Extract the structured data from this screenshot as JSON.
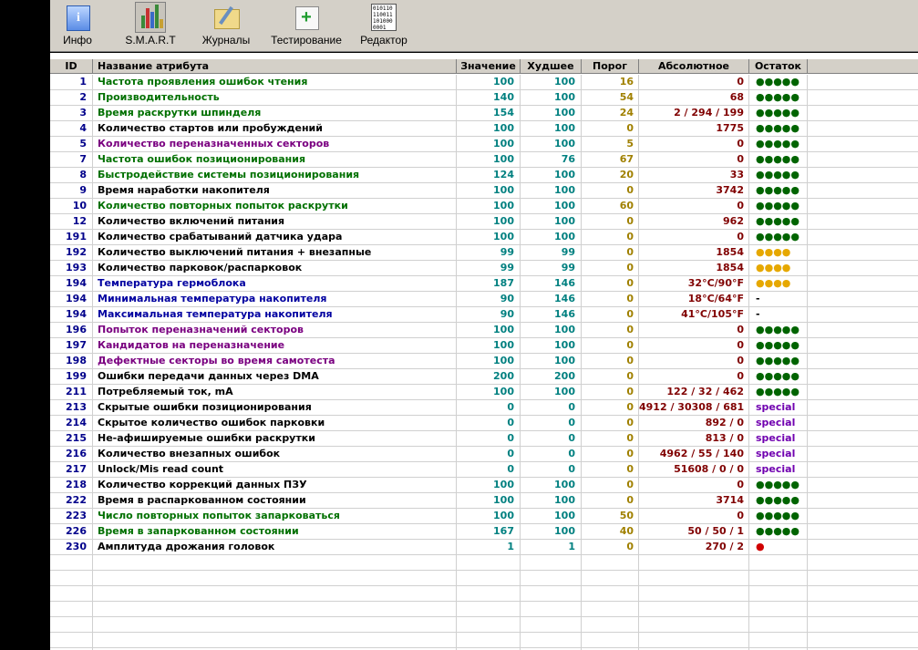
{
  "toolbar": {
    "buttons": [
      {
        "label": "Инфо",
        "icon": "info-icon"
      },
      {
        "label": "S.M.A.R.T",
        "icon": "smart-chart-icon"
      },
      {
        "label": "Журналы",
        "icon": "journal-icon"
      },
      {
        "label": "Тестирование",
        "icon": "test-kit-icon"
      },
      {
        "label": "Редактор",
        "icon": "binary-editor-icon"
      }
    ],
    "editor_icon_text": "010110\n110011\n101000\n0001"
  },
  "table": {
    "columns": [
      "ID",
      "Название атрибута",
      "Значение",
      "Худшее",
      "Порог",
      "Абсолютное",
      "Остаток"
    ],
    "rows": [
      {
        "id": "1",
        "name": "Частота проявления ошибок чтения",
        "value": "100",
        "worst": "100",
        "threshold": "16",
        "raw": "0",
        "rest": "●●●●●",
        "name_color": "#007000",
        "rest_color": "#006400"
      },
      {
        "id": "2",
        "name": "Производительность",
        "value": "140",
        "worst": "100",
        "threshold": "54",
        "raw": "68",
        "rest": "●●●●●",
        "name_color": "#007000",
        "rest_color": "#006400"
      },
      {
        "id": "3",
        "name": "Время раскрутки шпинделя",
        "value": "154",
        "worst": "100",
        "threshold": "24",
        "raw": "2 / 294 / 199",
        "rest": "●●●●●",
        "name_color": "#007000",
        "rest_color": "#006400"
      },
      {
        "id": "4",
        "name": "Количество стартов или пробуждений",
        "value": "100",
        "worst": "100",
        "threshold": "0",
        "raw": "1775",
        "rest": "●●●●●",
        "name_color": "#000000",
        "rest_color": "#006400"
      },
      {
        "id": "5",
        "name": "Количество переназначенных секторов",
        "value": "100",
        "worst": "100",
        "threshold": "5",
        "raw": "0",
        "rest": "●●●●●",
        "name_color": "#7a0080",
        "rest_color": "#006400"
      },
      {
        "id": "7",
        "name": "Частота ошибок позиционирования",
        "value": "100",
        "worst": "76",
        "threshold": "67",
        "raw": "0",
        "rest": "●●●●●",
        "name_color": "#007000",
        "rest_color": "#006400"
      },
      {
        "id": "8",
        "name": "Быстродействие системы позиционирования",
        "value": "124",
        "worst": "100",
        "threshold": "20",
        "raw": "33",
        "rest": "●●●●●",
        "name_color": "#007000",
        "rest_color": "#006400"
      },
      {
        "id": "9",
        "name": "Время наработки накопителя",
        "value": "100",
        "worst": "100",
        "threshold": "0",
        "raw": "3742",
        "rest": "●●●●●",
        "name_color": "#000000",
        "rest_color": "#006400"
      },
      {
        "id": "10",
        "name": "Количество повторных попыток раскрутки",
        "value": "100",
        "worst": "100",
        "threshold": "60",
        "raw": "0",
        "rest": "●●●●●",
        "name_color": "#007000",
        "rest_color": "#006400"
      },
      {
        "id": "12",
        "name": "Количество включений питания",
        "value": "100",
        "worst": "100",
        "threshold": "0",
        "raw": "962",
        "rest": "●●●●●",
        "name_color": "#000000",
        "rest_color": "#006400"
      },
      {
        "id": "191",
        "name": "Количество срабатываний датчика удара",
        "value": "100",
        "worst": "100",
        "threshold": "0",
        "raw": "0",
        "rest": "●●●●●",
        "name_color": "#000000",
        "rest_color": "#006400"
      },
      {
        "id": "192",
        "name": "Количество выключений питания + внезапные",
        "value": "99",
        "worst": "99",
        "threshold": "0",
        "raw": "1854",
        "rest": "●●●●",
        "name_color": "#000000",
        "rest_color": "#e6a800"
      },
      {
        "id": "193",
        "name": "Количество парковок/распарковок",
        "value": "99",
        "worst": "99",
        "threshold": "0",
        "raw": "1854",
        "rest": "●●●●",
        "name_color": "#000000",
        "rest_color": "#e6a800"
      },
      {
        "id": "194",
        "name": "Температура гермоблока",
        "value": "187",
        "worst": "146",
        "threshold": "0",
        "raw": "32°C/90°F",
        "rest": "●●●●",
        "name_color": "#0000a0",
        "rest_color": "#e6a800"
      },
      {
        "id": "194",
        "name": "Минимальная температура накопителя",
        "value": "90",
        "worst": "146",
        "threshold": "0",
        "raw": "18°C/64°F",
        "rest": "-",
        "name_color": "#0000a0",
        "rest_color": "#000000"
      },
      {
        "id": "194",
        "name": "Максимальная температура накопителя",
        "value": "90",
        "worst": "146",
        "threshold": "0",
        "raw": "41°C/105°F",
        "rest": "-",
        "name_color": "#0000a0",
        "rest_color": "#000000"
      },
      {
        "id": "196",
        "name": "Попыток переназначений секторов",
        "value": "100",
        "worst": "100",
        "threshold": "0",
        "raw": "0",
        "rest": "●●●●●",
        "name_color": "#7a0080",
        "rest_color": "#006400"
      },
      {
        "id": "197",
        "name": "Кандидатов на переназначение",
        "value": "100",
        "worst": "100",
        "threshold": "0",
        "raw": "0",
        "rest": "●●●●●",
        "name_color": "#7a0080",
        "rest_color": "#006400"
      },
      {
        "id": "198",
        "name": "Дефектные секторы во время самотеста",
        "value": "100",
        "worst": "100",
        "threshold": "0",
        "raw": "0",
        "rest": "●●●●●",
        "name_color": "#7a0080",
        "rest_color": "#006400"
      },
      {
        "id": "199",
        "name": "Ошибки передачи данных через DMA",
        "value": "200",
        "worst": "200",
        "threshold": "0",
        "raw": "0",
        "rest": "●●●●●",
        "name_color": "#000000",
        "rest_color": "#006400"
      },
      {
        "id": "211",
        "name": "Потребляемый ток, mA",
        "value": "100",
        "worst": "100",
        "threshold": "0",
        "raw": "122 / 32 / 462",
        "rest": "●●●●●",
        "name_color": "#000000",
        "rest_color": "#006400"
      },
      {
        "id": "213",
        "name": "Скрытые ошибки позиционирования",
        "value": "0",
        "worst": "0",
        "threshold": "0",
        "raw": "4912 / 30308 / 681",
        "rest": "special",
        "name_color": "#000000",
        "rest_color": "#7000b0"
      },
      {
        "id": "214",
        "name": "Скрытое количество ошибок парковки",
        "value": "0",
        "worst": "0",
        "threshold": "0",
        "raw": "892 / 0",
        "rest": "special",
        "name_color": "#000000",
        "rest_color": "#7000b0"
      },
      {
        "id": "215",
        "name": "Не-афишируемые ошибки раскрутки",
        "value": "0",
        "worst": "0",
        "threshold": "0",
        "raw": "813 / 0",
        "rest": "special",
        "name_color": "#000000",
        "rest_color": "#7000b0"
      },
      {
        "id": "216",
        "name": "Количество внезапных ошибок",
        "value": "0",
        "worst": "0",
        "threshold": "0",
        "raw": "4962 / 55 / 140",
        "rest": "special",
        "name_color": "#000000",
        "rest_color": "#7000b0"
      },
      {
        "id": "217",
        "name": "Unlock/Mis read count",
        "value": "0",
        "worst": "0",
        "threshold": "0",
        "raw": "51608 / 0 / 0",
        "rest": "special",
        "name_color": "#000000",
        "rest_color": "#7000b0"
      },
      {
        "id": "218",
        "name": "Количество коррекций данных ПЗУ",
        "value": "100",
        "worst": "100",
        "threshold": "0",
        "raw": "0",
        "rest": "●●●●●",
        "name_color": "#000000",
        "rest_color": "#006400"
      },
      {
        "id": "222",
        "name": "Время в распаркованном состоянии",
        "value": "100",
        "worst": "100",
        "threshold": "0",
        "raw": "3714",
        "rest": "●●●●●",
        "name_color": "#000000",
        "rest_color": "#006400"
      },
      {
        "id": "223",
        "name": "Число повторных попыток запарковаться",
        "value": "100",
        "worst": "100",
        "threshold": "50",
        "raw": "0",
        "rest": "●●●●●",
        "name_color": "#007000",
        "rest_color": "#006400"
      },
      {
        "id": "226",
        "name": "Время в запаркованном состоянии",
        "value": "167",
        "worst": "100",
        "threshold": "40",
        "raw": "50 / 50 / 1",
        "rest": "●●●●●",
        "name_color": "#007000",
        "rest_color": "#006400"
      },
      {
        "id": "230",
        "name": "Амплитуда дрожания головок",
        "value": "1",
        "worst": "1",
        "threshold": "0",
        "raw": "270 / 2",
        "rest": "●",
        "name_color": "#000000",
        "rest_color": "#d00000"
      }
    ]
  }
}
